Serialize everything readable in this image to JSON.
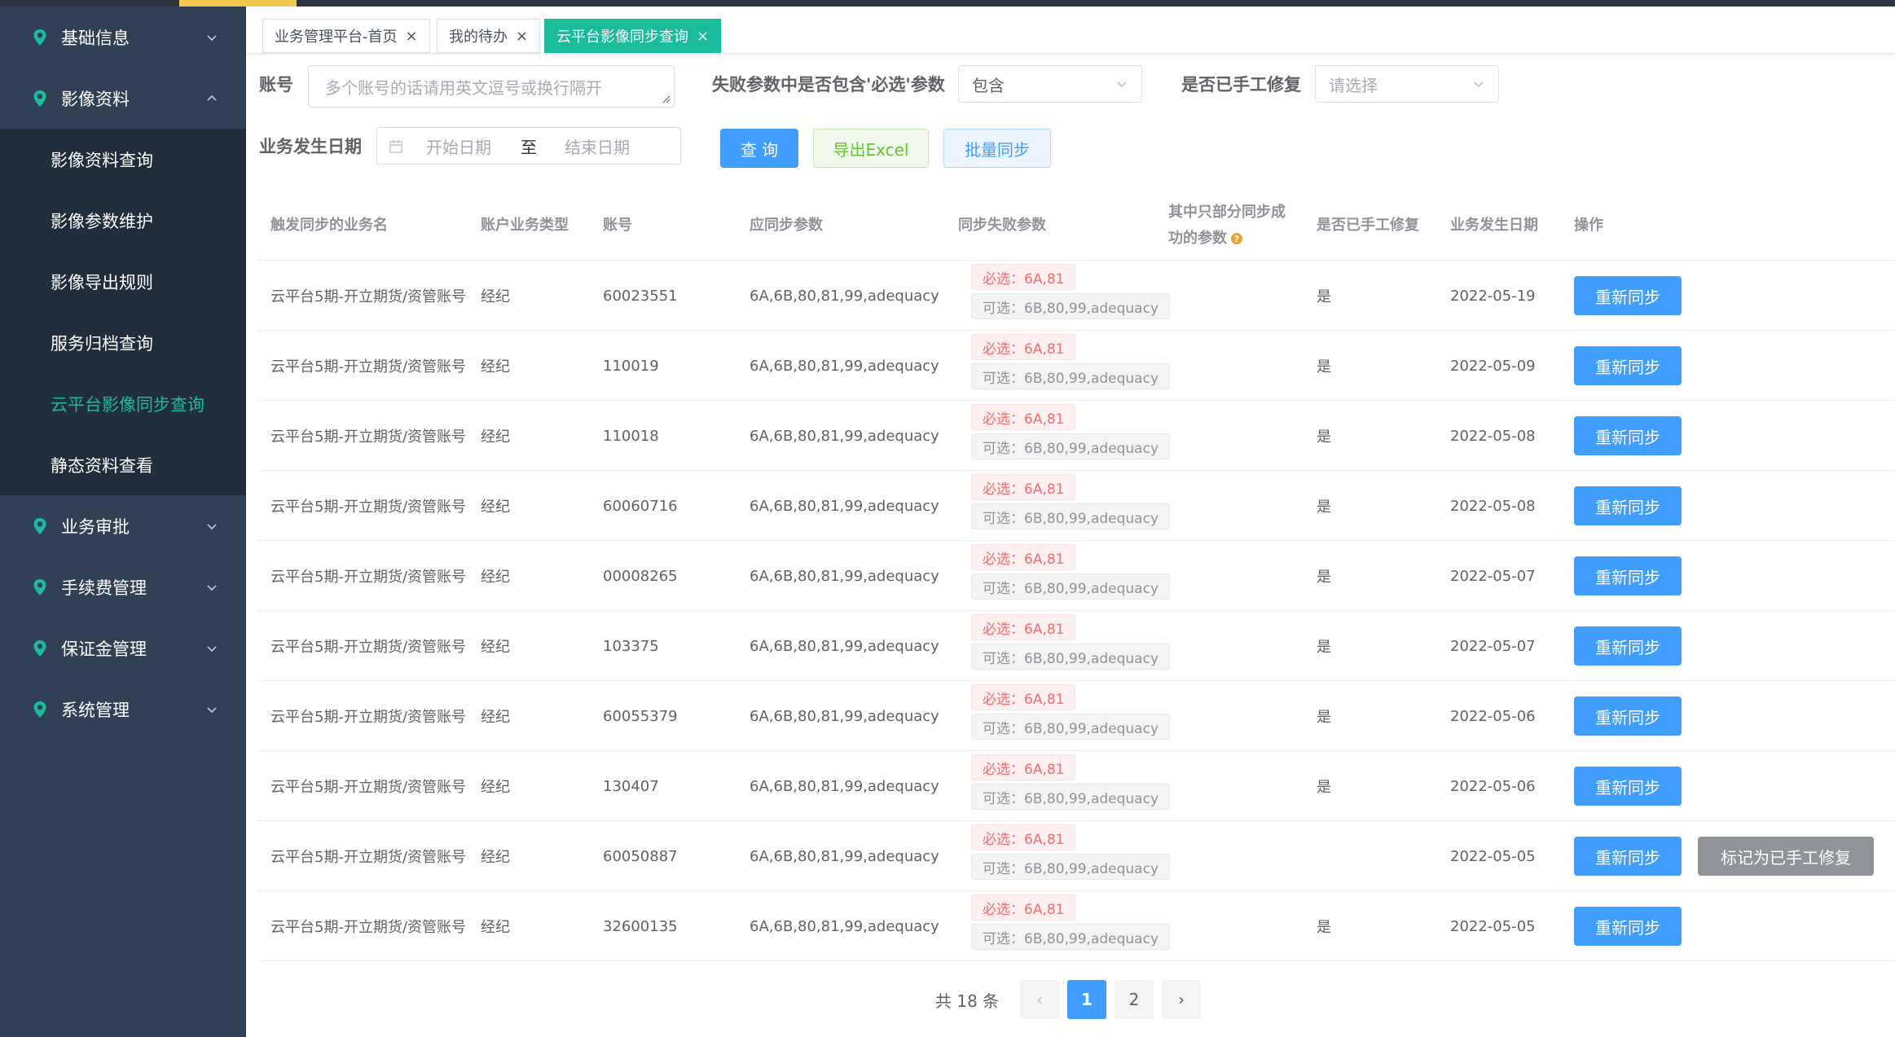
{
  "colors": {
    "sidebar": "#304156",
    "submenu": "#1f2d3d",
    "accent": "#1abc9c",
    "primary": "#409eff",
    "danger": "#f56c6c",
    "info": "#909399"
  },
  "sidebar": {
    "groups": [
      {
        "label": "基础信息",
        "icon": "location-pin-icon",
        "expanded": false
      },
      {
        "label": "影像资料",
        "icon": "location-pin-icon",
        "expanded": true,
        "children": [
          "影像资料查询",
          "影像参数维护",
          "影像导出规则",
          "服务归档查询",
          "云平台影像同步查询",
          "静态资料查看"
        ],
        "active_child": "云平台影像同步查询"
      },
      {
        "label": "业务审批",
        "icon": "location-pin-icon",
        "expanded": false
      },
      {
        "label": "手续费管理",
        "icon": "location-pin-icon",
        "expanded": false
      },
      {
        "label": "保证金管理",
        "icon": "location-pin-icon",
        "expanded": false
      },
      {
        "label": "系统管理",
        "icon": "location-pin-icon",
        "expanded": false
      }
    ]
  },
  "tabs": [
    {
      "label": "业务管理平台-首页",
      "close": "×",
      "active": false
    },
    {
      "label": "我的待办",
      "close": "×",
      "active": false
    },
    {
      "label": "云平台影像同步查询",
      "close": "×",
      "active": true
    }
  ],
  "filters": {
    "account_label": "账号",
    "account_placeholder": "多个账号的话请用英文逗号或换行隔开",
    "failed_label": "失败参数中是否包含'必选'参数",
    "failed_value": "包含",
    "repaired_label": "是否已手工修复",
    "repaired_placeholder": "请选择",
    "date_label": "业务发生日期",
    "date_start_placeholder": "开始日期",
    "date_sep": "至",
    "date_end_placeholder": "结束日期"
  },
  "actions": {
    "query": "查 询",
    "export": "导出Excel",
    "batch_sync": "批量同步"
  },
  "table": {
    "headers": {
      "biz_name": "触发同步的业务名",
      "acct_type": "账户业务类型",
      "account": "账号",
      "should_params": "应同步参数",
      "failed_params": "同步失败参数",
      "partial_line1": "其中只部分同步成",
      "partial_line2": "功的参数",
      "repaired": "是否已手工修复",
      "date": "业务发生日期",
      "ops": "操作"
    },
    "rows": [
      {
        "biz_name": "云平台5期-开立期货/资管账号",
        "acct_type": "经纪",
        "account": "60023551",
        "should_params": "6A,6B,80,81,99,adequacy",
        "required_tag": "必选：6A,81",
        "optional_tag": "可选：6B,80,99,adequacy",
        "repaired": "是",
        "date": "2022-05-19",
        "resync": "重新同步",
        "mark_repaired": ""
      },
      {
        "biz_name": "云平台5期-开立期货/资管账号",
        "acct_type": "经纪",
        "account": "110019",
        "should_params": "6A,6B,80,81,99,adequacy",
        "required_tag": "必选：6A,81",
        "optional_tag": "可选：6B,80,99,adequacy",
        "repaired": "是",
        "date": "2022-05-09",
        "resync": "重新同步",
        "mark_repaired": ""
      },
      {
        "biz_name": "云平台5期-开立期货/资管账号",
        "acct_type": "经纪",
        "account": "110018",
        "should_params": "6A,6B,80,81,99,adequacy",
        "required_tag": "必选：6A,81",
        "optional_tag": "可选：6B,80,99,adequacy",
        "repaired": "是",
        "date": "2022-05-08",
        "resync": "重新同步",
        "mark_repaired": ""
      },
      {
        "biz_name": "云平台5期-开立期货/资管账号",
        "acct_type": "经纪",
        "account": "60060716",
        "should_params": "6A,6B,80,81,99,adequacy",
        "required_tag": "必选：6A,81",
        "optional_tag": "可选：6B,80,99,adequacy",
        "repaired": "是",
        "date": "2022-05-08",
        "resync": "重新同步",
        "mark_repaired": ""
      },
      {
        "biz_name": "云平台5期-开立期货/资管账号",
        "acct_type": "经纪",
        "account": "00008265",
        "should_params": "6A,6B,80,81,99,adequacy",
        "required_tag": "必选：6A,81",
        "optional_tag": "可选：6B,80,99,adequacy",
        "repaired": "是",
        "date": "2022-05-07",
        "resync": "重新同步",
        "mark_repaired": ""
      },
      {
        "biz_name": "云平台5期-开立期货/资管账号",
        "acct_type": "经纪",
        "account": "103375",
        "should_params": "6A,6B,80,81,99,adequacy",
        "required_tag": "必选：6A,81",
        "optional_tag": "可选：6B,80,99,adequacy",
        "repaired": "是",
        "date": "2022-05-07",
        "resync": "重新同步",
        "mark_repaired": ""
      },
      {
        "biz_name": "云平台5期-开立期货/资管账号",
        "acct_type": "经纪",
        "account": "60055379",
        "should_params": "6A,6B,80,81,99,adequacy",
        "required_tag": "必选：6A,81",
        "optional_tag": "可选：6B,80,99,adequacy",
        "repaired": "是",
        "date": "2022-05-06",
        "resync": "重新同步",
        "mark_repaired": ""
      },
      {
        "biz_name": "云平台5期-开立期货/资管账号",
        "acct_type": "经纪",
        "account": "130407",
        "should_params": "6A,6B,80,81,99,adequacy",
        "required_tag": "必选：6A,81",
        "optional_tag": "可选：6B,80,99,adequacy",
        "repaired": "是",
        "date": "2022-05-06",
        "resync": "重新同步",
        "mark_repaired": ""
      },
      {
        "biz_name": "云平台5期-开立期货/资管账号",
        "acct_type": "经纪",
        "account": "60050887",
        "should_params": "6A,6B,80,81,99,adequacy",
        "required_tag": "必选：6A,81",
        "optional_tag": "可选：6B,80,99,adequacy",
        "repaired": "",
        "date": "2022-05-05",
        "resync": "重新同步",
        "mark_repaired": "标记为已手工修复"
      },
      {
        "biz_name": "云平台5期-开立期货/资管账号",
        "acct_type": "经纪",
        "account": "32600135",
        "should_params": "6A,6B,80,81,99,adequacy",
        "required_tag": "必选：6A,81",
        "optional_tag": "可选：6B,80,99,adequacy",
        "repaired": "是",
        "date": "2022-05-05",
        "resync": "重新同步",
        "mark_repaired": ""
      }
    ]
  },
  "pagination": {
    "total": "共 18 条",
    "prev": "‹",
    "next": "›",
    "pages": [
      "1",
      "2"
    ],
    "current": "1"
  }
}
